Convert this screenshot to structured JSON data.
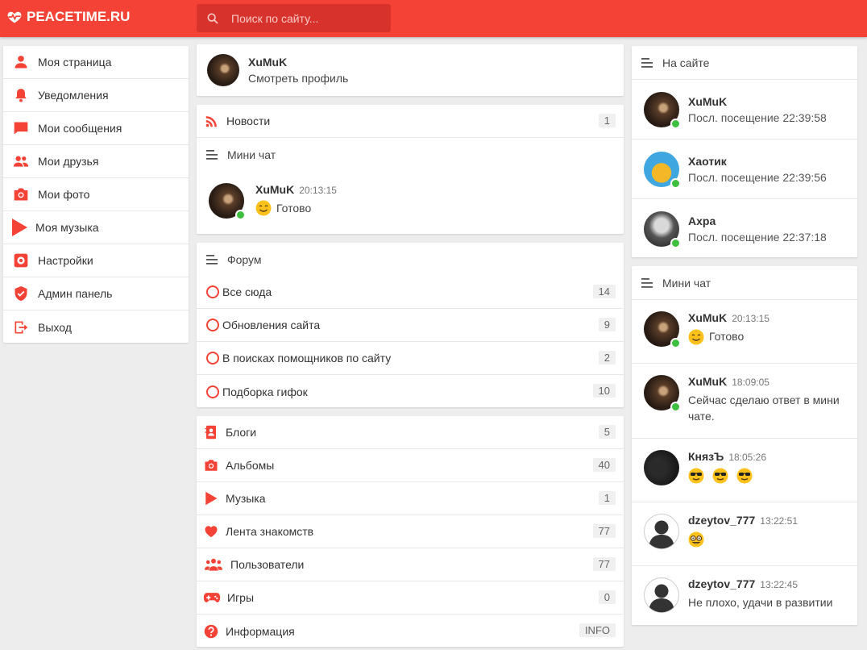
{
  "brand": {
    "name": "PEACETIME.RU",
    "accent": "#f44336"
  },
  "search": {
    "placeholder": "Поиск по сайту..."
  },
  "menu": [
    {
      "label": "Моя страница",
      "icon": "person-icon"
    },
    {
      "label": "Уведомления",
      "icon": "bell-icon"
    },
    {
      "label": "Мои сообщения",
      "icon": "chat-icon"
    },
    {
      "label": "Мои друзья",
      "icon": "friends-icon"
    },
    {
      "label": "Мои фото",
      "icon": "camera-icon"
    },
    {
      "label": "Моя музыка",
      "icon": "play-icon"
    },
    {
      "label": "Настройки",
      "icon": "gear-icon"
    },
    {
      "label": "Админ панель",
      "icon": "shield-icon"
    },
    {
      "label": "Выход",
      "icon": "logout-icon"
    }
  ],
  "profile": {
    "name": "XuMuK",
    "link": "Смотреть профиль"
  },
  "news": {
    "label": "Новости",
    "count": "1"
  },
  "minichat": {
    "title": "Мини чат",
    "message": {
      "user": "XuMuK",
      "time": "20:13:15",
      "text": "Готово"
    }
  },
  "forum": {
    "title": "Форум",
    "items": [
      {
        "label": "Все сюда",
        "count": "14"
      },
      {
        "label": "Обновления сайта",
        "count": "9"
      },
      {
        "label": "В поисках помощников по сайту",
        "count": "2"
      },
      {
        "label": "Подборка гифок",
        "count": "10"
      }
    ]
  },
  "categories": [
    {
      "label": "Блоги",
      "count": "5",
      "icon": "blog-icon"
    },
    {
      "label": "Альбомы",
      "count": "40",
      "icon": "camera-icon"
    },
    {
      "label": "Музыка",
      "count": "1",
      "icon": "play-icon"
    },
    {
      "label": "Лента знакомств",
      "count": "77",
      "icon": "heart-icon"
    },
    {
      "label": "Пользователи",
      "count": "77",
      "icon": "users-icon"
    },
    {
      "label": "Игры",
      "count": "0",
      "icon": "gamepad-icon"
    },
    {
      "label": "Информация",
      "count": "INFO",
      "icon": "question-icon"
    }
  ],
  "online": {
    "title": "На сайте",
    "users": [
      {
        "name": "XuMuK",
        "seen": "Посл. посещение 22:39:58"
      },
      {
        "name": "Хаотик",
        "seen": "Посл. посещение 22:39:56"
      },
      {
        "name": "Axpa",
        "seen": "Посл. посещение 22:37:18"
      }
    ]
  },
  "minichat2": {
    "title": "Мини чат",
    "messages": [
      {
        "user": "XuMuK",
        "time": "20:13:15",
        "text": "Готово"
      },
      {
        "user": "XuMuK",
        "time": "18:09:05",
        "text": "Сейчас сделаю ответ в мини чате."
      },
      {
        "user": "КнязЪ",
        "time": "18:05:26",
        "text": ""
      },
      {
        "user": "dzeytov_777",
        "time": "13:22:51",
        "text": ""
      },
      {
        "user": "dzeytov_777",
        "time": "13:22:45",
        "text": "Не плохо, удачи в развитии"
      }
    ]
  }
}
